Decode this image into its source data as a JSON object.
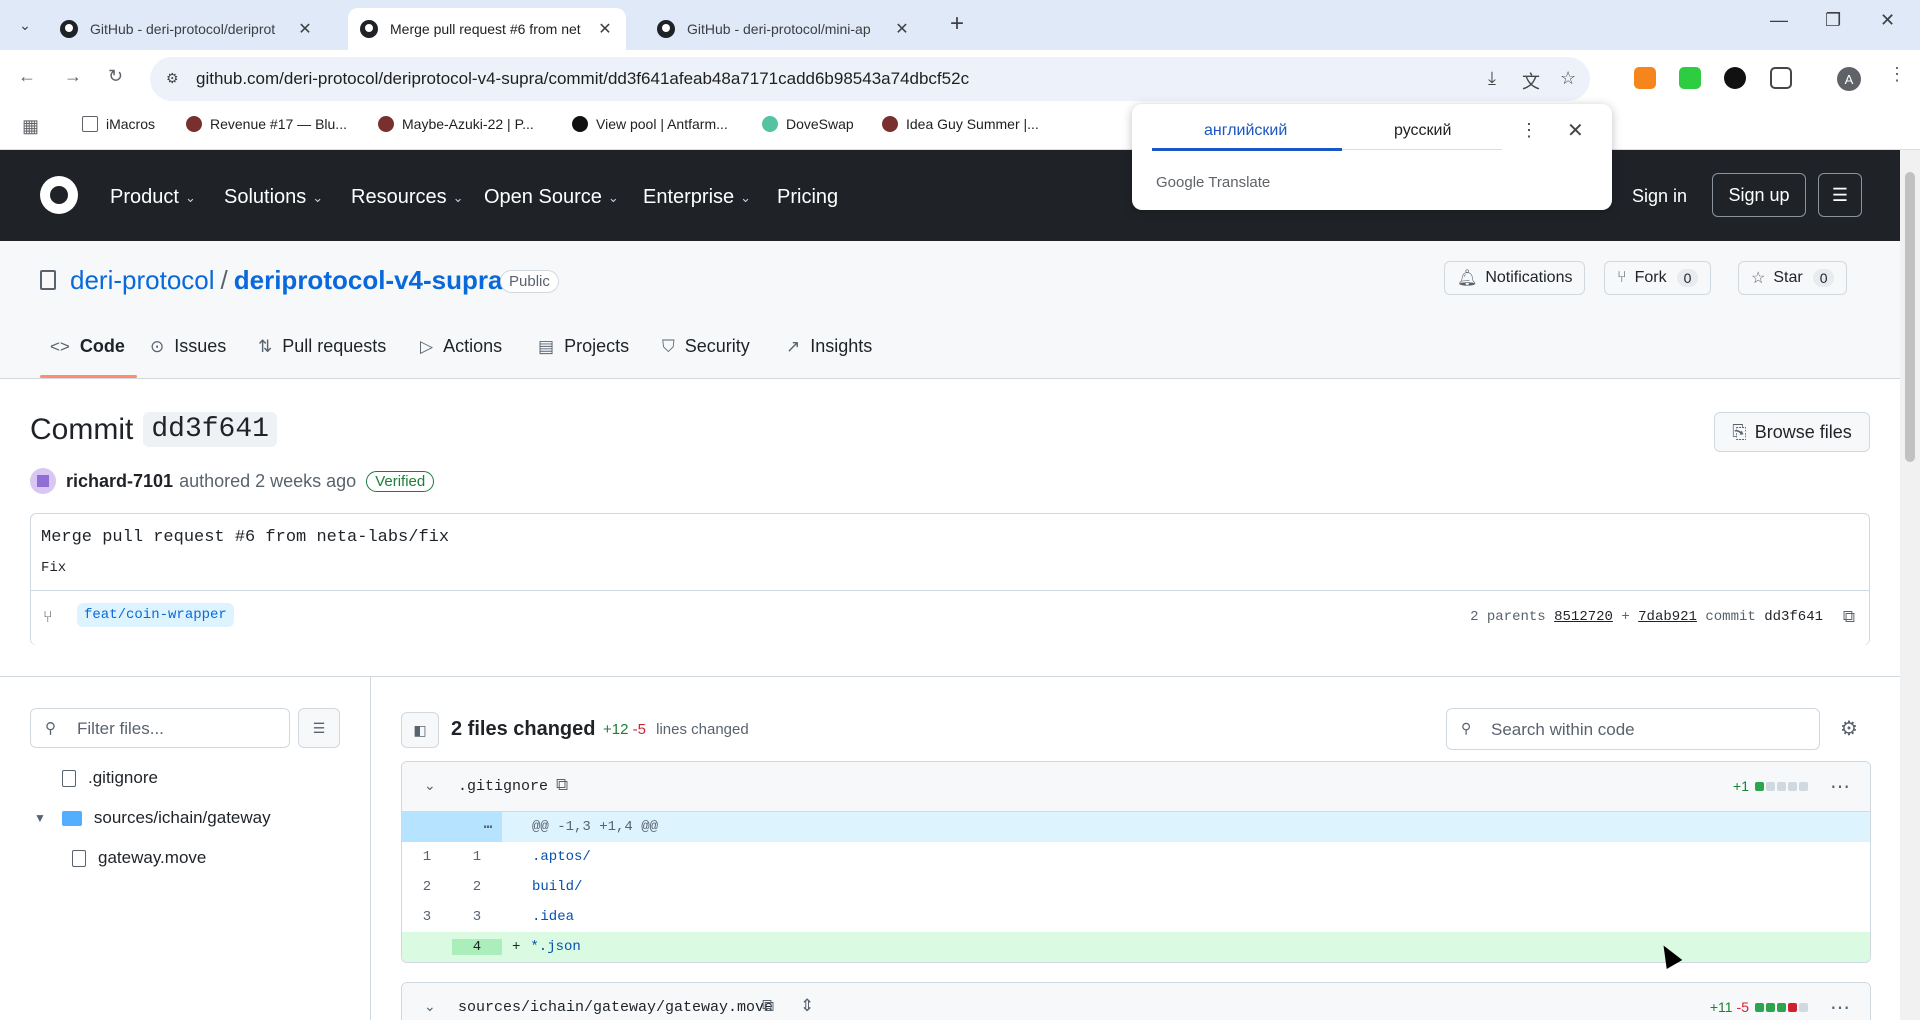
{
  "browser": {
    "tabs": [
      {
        "title": "GitHub - deri-protocol/deriprot",
        "active": false
      },
      {
        "title": "Merge pull request #6 from net",
        "active": true
      },
      {
        "title": "GitHub - deri-protocol/mini-ap",
        "active": false
      }
    ],
    "url": "github.com/deri-protocol/deriprotocol-v4-supra/commit/dd3f641afeab48a7171cadd6b98543a74dbcf52c",
    "avatar_letter": "A",
    "bookmarks": [
      {
        "label": "iMacros",
        "color": "#f4c542"
      },
      {
        "label": "Revenue #17 — Blu...",
        "color": "#7a2f2f"
      },
      {
        "label": "Maybe-Azuki-22 | P...",
        "color": "#7a2f2f"
      },
      {
        "label": "View pool | Antfarm...",
        "color": "#111111"
      },
      {
        "label": "DoveSwap",
        "color": "#55c2a1"
      },
      {
        "label": "Idea Guy Summer |...",
        "color": "#7a2f2f"
      }
    ]
  },
  "translate": {
    "source_lang": "английский",
    "target_lang": "русский",
    "brand_google": "Google",
    "brand_translate": "Translate"
  },
  "github": {
    "nav": [
      "Product",
      "Solutions",
      "Resources",
      "Open Source",
      "Enterprise",
      "Pricing"
    ],
    "sign_in": "Sign in",
    "sign_up": "Sign up"
  },
  "repo": {
    "owner": "deri-protocol",
    "separator": "/",
    "name": "deriprotocol-v4-supra",
    "visibility": "Public",
    "notifications": "Notifications",
    "fork_label": "Fork",
    "fork_count": "0",
    "star_label": "Star",
    "star_count": "0",
    "tabs": [
      "Code",
      "Issues",
      "Pull requests",
      "Actions",
      "Projects",
      "Security",
      "Insights"
    ]
  },
  "commit": {
    "heading": "Commit",
    "short_sha": "dd3f641",
    "browse_files": "Browse files",
    "author": "richard-7101",
    "authored": "authored 2 weeks ago",
    "verified": "Verified",
    "message_title": "Merge pull request #6 from neta-labs/fix",
    "message_body": "Fix",
    "branch": "feat/coin-wrapper",
    "parents_label": "2 parents",
    "parent1": "8512720",
    "plus": "+",
    "parent2": "7dab921",
    "commit_label": "commit",
    "commit_sha": "dd3f641"
  },
  "tree": {
    "filter_placeholder": "Filter files...",
    "items": [
      ".gitignore",
      "sources/ichain/gateway",
      "gateway.move"
    ]
  },
  "diff": {
    "files_changed": "2 files changed",
    "additions": "+12",
    "deletions": "-5",
    "lines_changed": "lines changed",
    "search_placeholder": "Search within code",
    "file1": {
      "name": ".gitignore",
      "stat_add": "+1",
      "hunk": "@@ -1,3 +1,4 @@",
      "lines": [
        {
          "old": "1",
          "new": "1",
          "code": ".aptos/"
        },
        {
          "old": "2",
          "new": "2",
          "code": "build/"
        },
        {
          "old": "3",
          "new": "3",
          "code": ".idea"
        }
      ],
      "added": {
        "new": "4",
        "sign": "+",
        "code": "*.json"
      }
    },
    "file2": {
      "name": "sources/ichain/gateway/gateway.move",
      "stat_add": "+11",
      "stat_del": "-5"
    }
  }
}
